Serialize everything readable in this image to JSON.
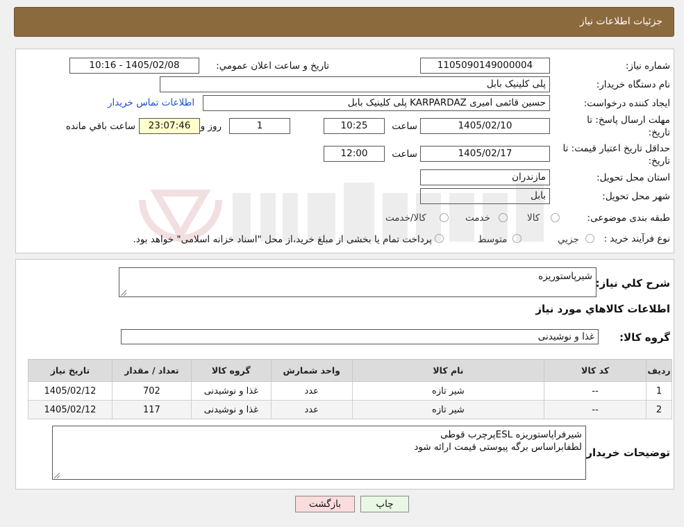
{
  "header": {
    "title": "جزئیات اطلاعات نیاز"
  },
  "form": {
    "need_number_label": "شماره نیاز:",
    "need_number": "1105090149000004",
    "announce_label": "تاریخ و ساعت اعلان عمومي:",
    "announce_value": "1405/02/08 - 10:16",
    "buyer_org_label": "نام دستگاه خريدار:",
    "buyer_org": "پلی کلینیک بابل",
    "creator_label": "ايجاد کننده درخواست:",
    "creator": "حسین قائمی امیری KARPARDAZ پلی کلینیک بابل",
    "contact_link": "اطلاعات تماس خريدار",
    "deadline_label_1": "مهلت ارسال پاسخ: تا",
    "deadline_label_2": "تاريخ:",
    "deadline_date": "1405/02/10",
    "time_label": "ساعت",
    "deadline_time": "10:25",
    "days_value": "1",
    "days_label": "روز و",
    "remaining_time": "23:07:46",
    "remaining_label": "ساعت باقي مانده",
    "validity_label_1": "حداقل تاريخ اعتبار قيمت: تا",
    "validity_label_2": "تاريخ:",
    "validity_date": "1405/02/17",
    "validity_time": "12:00",
    "province_label": "استان محل تحويل:",
    "province": "مازندران",
    "city_label": "شهر محل تحويل:",
    "city": "بابل",
    "category_label": "طبقه بندی موضوعی:",
    "category_options": [
      "کالا",
      "خدمت",
      "کالا/خدمت"
    ],
    "process_label": "نوع فرآيند خريد :",
    "process_options": [
      "جزيي",
      "متوسط"
    ],
    "process_note": "پرداخت تمام يا بخشی از مبلغ خريد،از محل \"اسناد خزانه اسلامی\" خواهد بود."
  },
  "details": {
    "summary_label": "شرح كلي نياز:",
    "summary": "شیرپاستوریزه",
    "items_heading": "اطلاعات كالاهاي مورد نياز",
    "group_label": "گروه كالا:",
    "group_value": "غذا و نوشیدنی",
    "table": {
      "headers": [
        "رديف",
        "كد كالا",
        "نام كالا",
        "واحد شمارش",
        "گروه كالا",
        "تعداد / مقدار",
        "تاريخ نياز"
      ],
      "rows": [
        [
          "1",
          "--",
          "شیر تازه",
          "عدد",
          "غذا و نوشیدنی",
          "702",
          "1405/02/12"
        ],
        [
          "2",
          "--",
          "شیر تازه",
          "عدد",
          "غذا و نوشیدنی",
          "117",
          "1405/02/12"
        ]
      ]
    },
    "buyer_notes_label": "توضيحات خريدار:",
    "buyer_notes_line1": "شیرفراپاستوریزه ESLپرچرب قوطی",
    "buyer_notes_line2": "لطفابراساس برگه پیوستی قیمت ارائه شود"
  },
  "buttons": {
    "back": "بازگشت",
    "print": "چاپ"
  }
}
